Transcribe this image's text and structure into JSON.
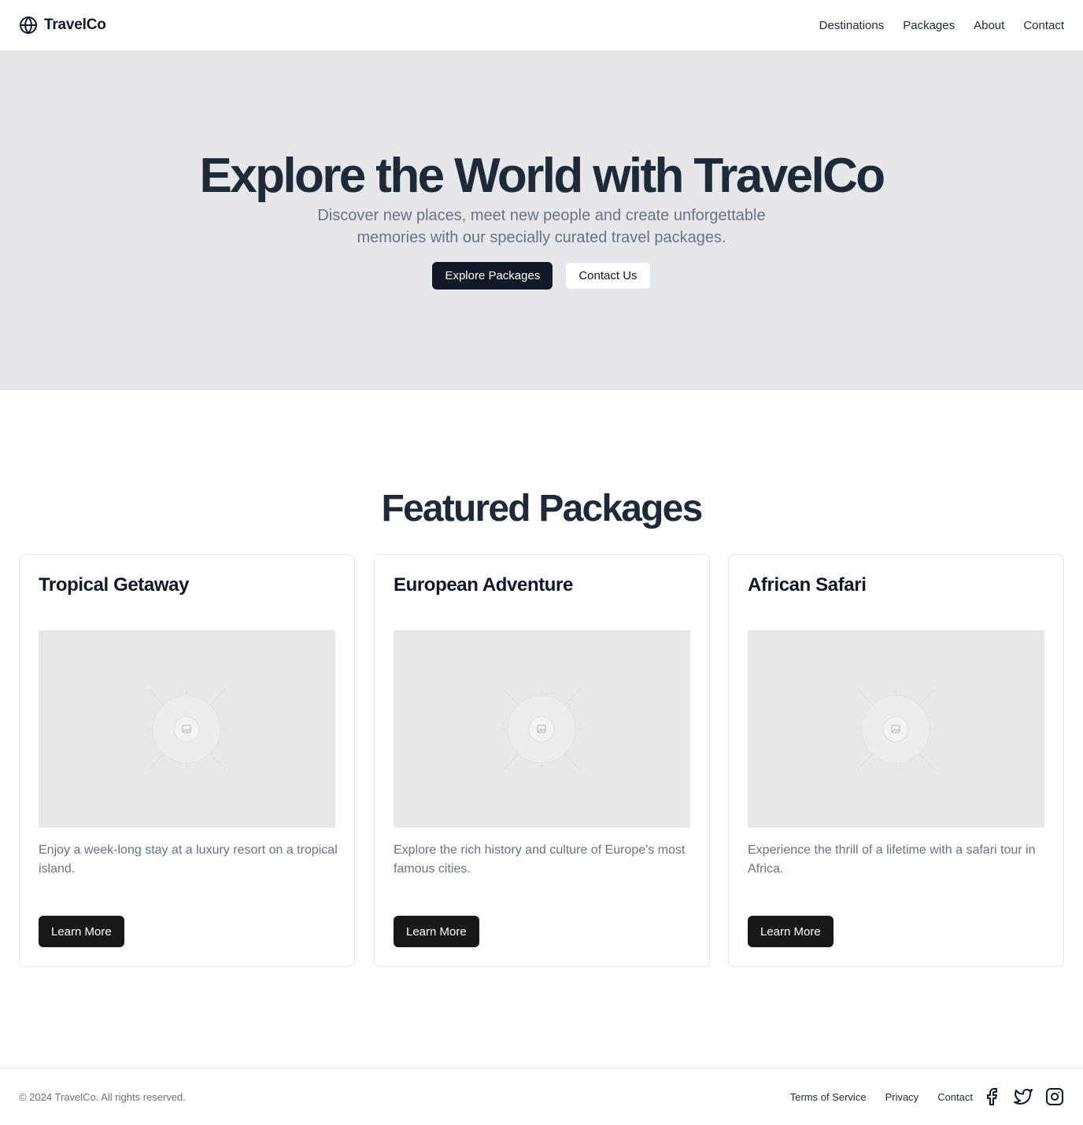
{
  "header": {
    "brand": "TravelCo",
    "brand_icon": "globe-icon",
    "nav": [
      "Destinations",
      "Packages",
      "About",
      "Contact"
    ]
  },
  "hero": {
    "title": "Explore the World with TravelCo",
    "subtitle": "Discover new places, meet new people and create unforgettable memories with our specially curated travel packages.",
    "primary_button": "Explore Packages",
    "secondary_button": "Contact Us"
  },
  "featured": {
    "title": "Featured Packages",
    "cards": [
      {
        "title": "Tropical Getaway",
        "description": "Enjoy a week-long stay at a luxury resort on a tropical island.",
        "button": "Learn More",
        "image_icon": "image-placeholder-icon"
      },
      {
        "title": "European Adventure",
        "description": "Explore the rich history and culture of Europe's most famous cities.",
        "button": "Learn More",
        "image_icon": "image-placeholder-icon"
      },
      {
        "title": "African Safari",
        "description": "Experience the thrill of a lifetime with a safari tour in Africa.",
        "button": "Learn More",
        "image_icon": "image-placeholder-icon"
      }
    ]
  },
  "footer": {
    "copyright": "© 2024 TravelCo. All rights reserved.",
    "links": [
      "Terms of Service",
      "Privacy",
      "Contact"
    ],
    "social_icons": [
      "facebook-icon",
      "twitter-icon",
      "instagram-icon"
    ]
  },
  "colors": {
    "primary": "#111827",
    "hero_bg": "#e5e7eb",
    "muted_text": "#6b7280",
    "placeholder_bg": "#e8e8e8"
  }
}
